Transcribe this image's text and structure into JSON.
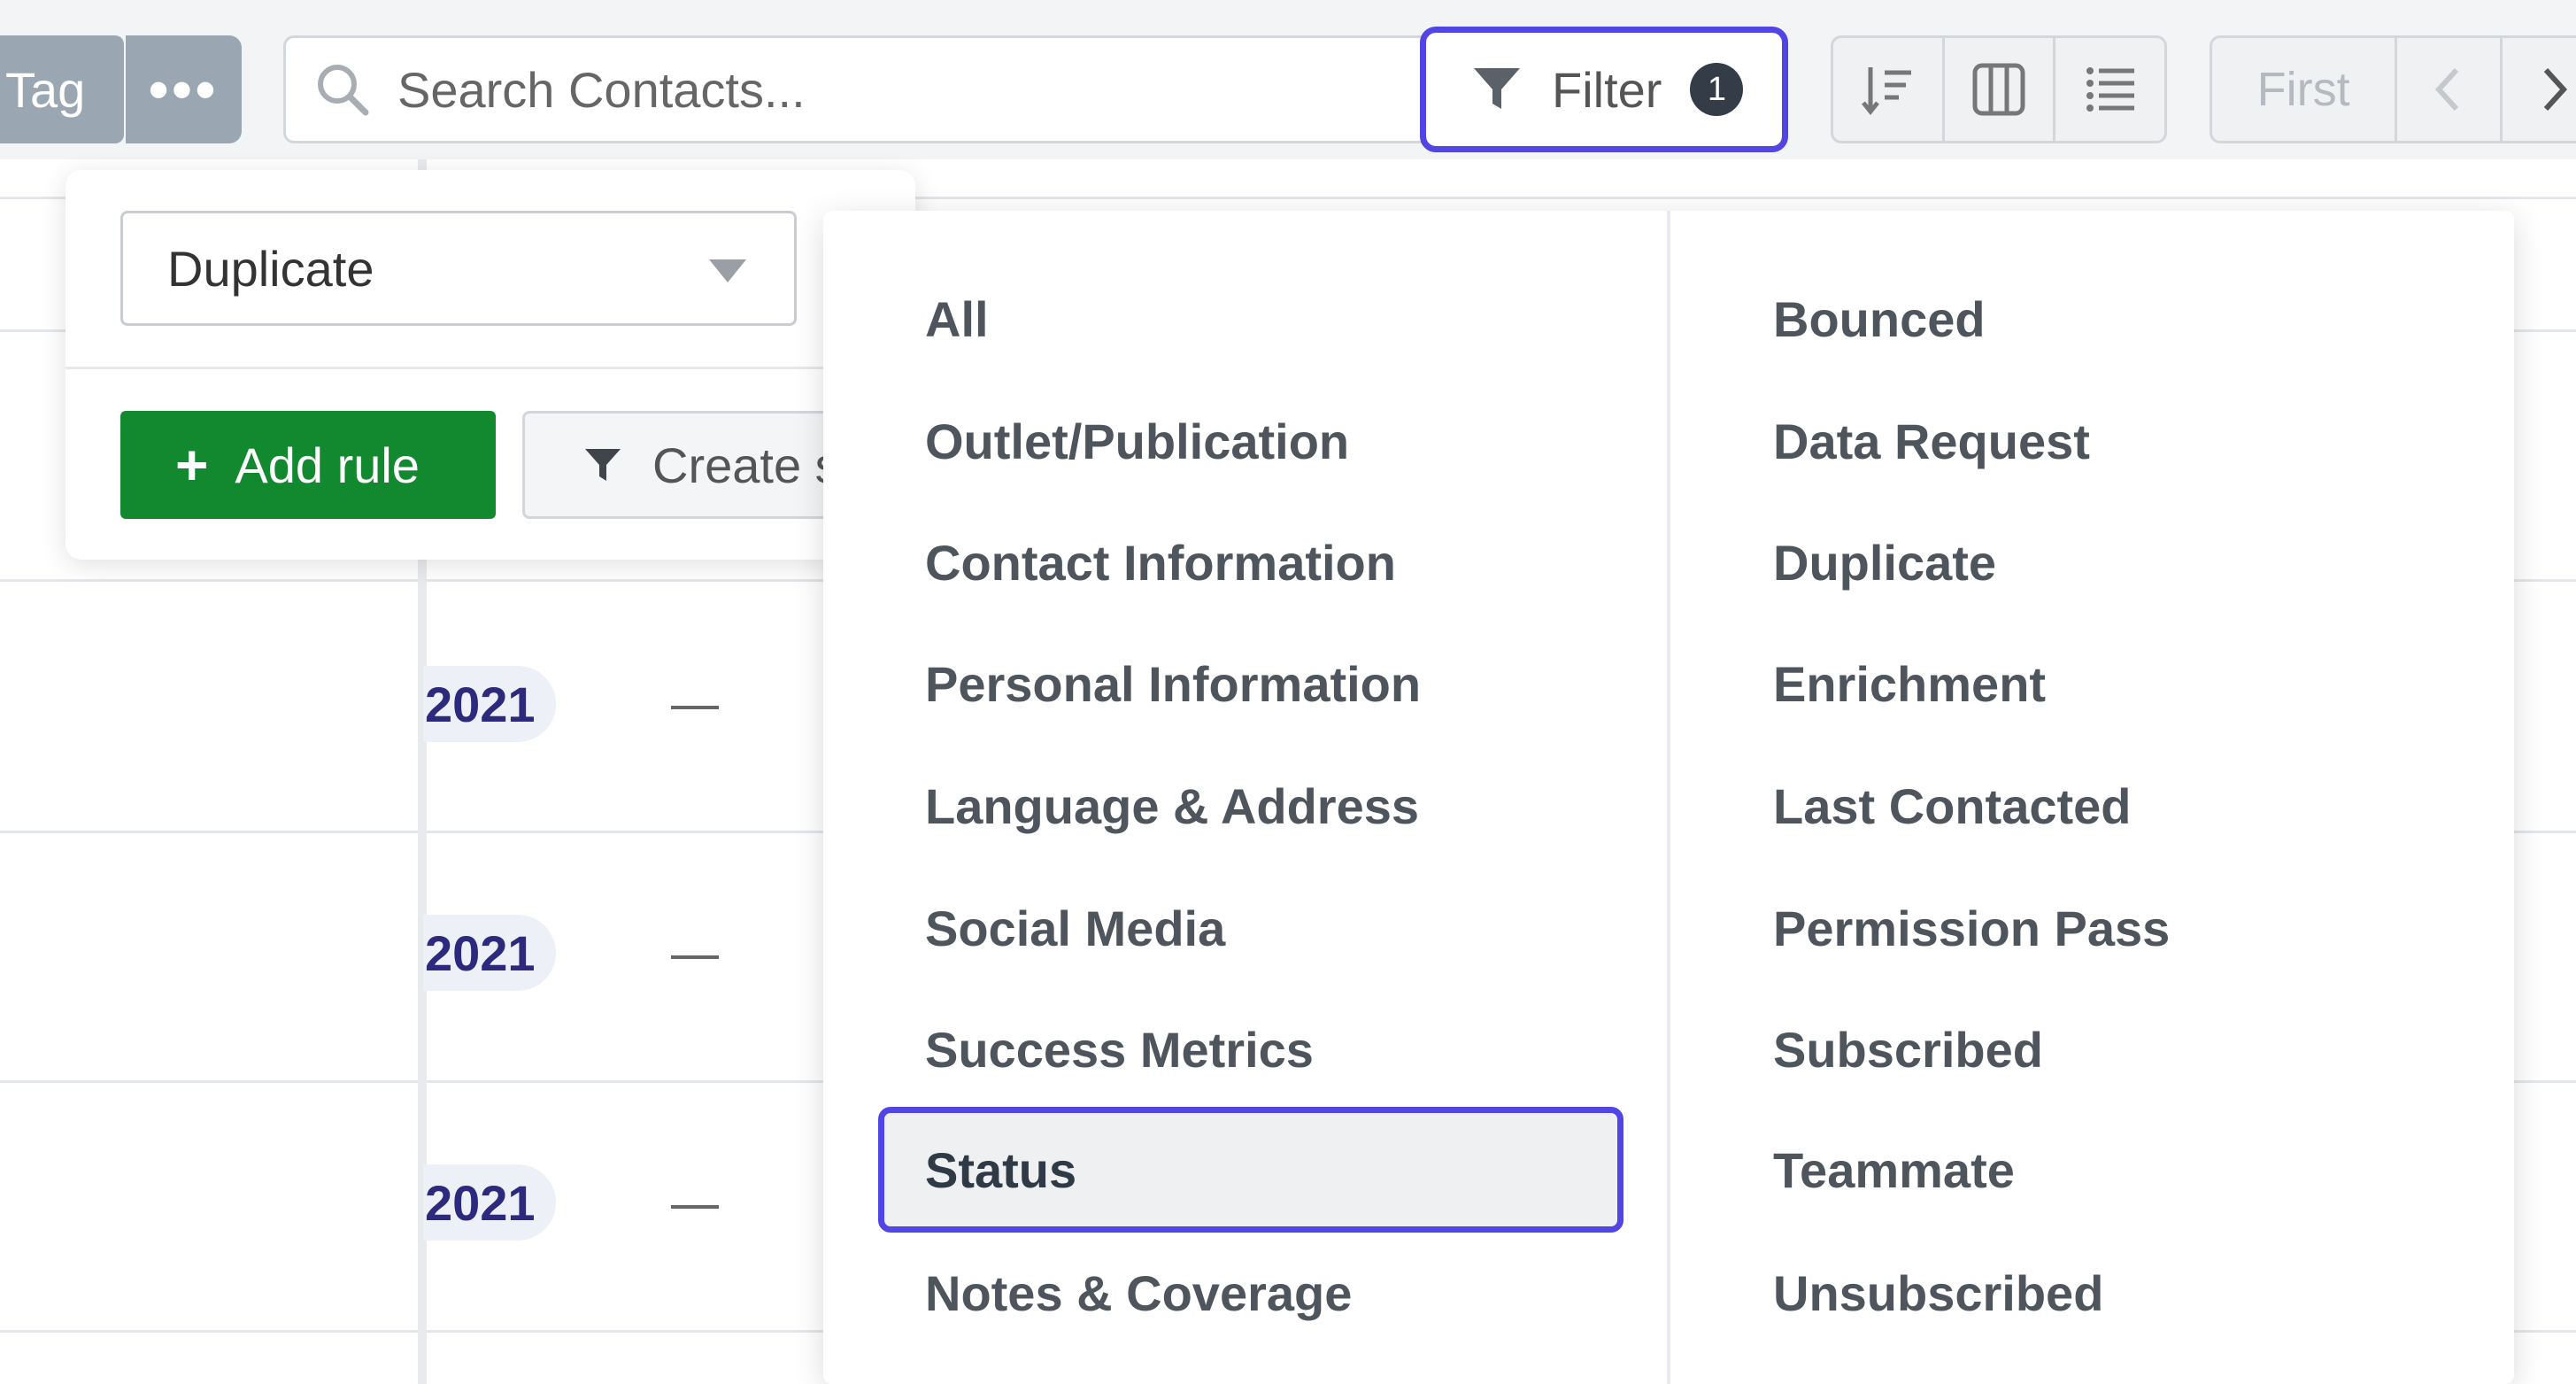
{
  "toolbar": {
    "tag_label": "Tag",
    "more_label": "•••",
    "search_placeholder": "Search Contacts...",
    "filter_label": "Filter",
    "filter_count": "1",
    "pager_first": "First"
  },
  "table": {
    "rows": [
      {
        "year": "2021",
        "dash": "—"
      },
      {
        "year": "2021",
        "dash": "—"
      },
      {
        "year": "2021",
        "dash": "—"
      }
    ]
  },
  "filter_panel": {
    "selected_category": "Duplicate",
    "add_rule_label": "Add rule",
    "create_label": "Create saved filter"
  },
  "categories": {
    "left": [
      "All",
      "Outlet/Publication",
      "Contact Information",
      "Personal Information",
      "Language & Address",
      "Social Media",
      "Success Metrics",
      "Status",
      "Notes & Coverage"
    ],
    "right": [
      "Bounced",
      "Data Request",
      "Duplicate",
      "Enrichment",
      "Last Contacted",
      "Permission Pass",
      "Subscribed",
      "Teammate",
      "Unsubscribed"
    ],
    "highlighted": "Status"
  },
  "colors": {
    "accent": "#5145e5",
    "primary_button": "#12892f",
    "year_text": "#2d2a7e"
  }
}
